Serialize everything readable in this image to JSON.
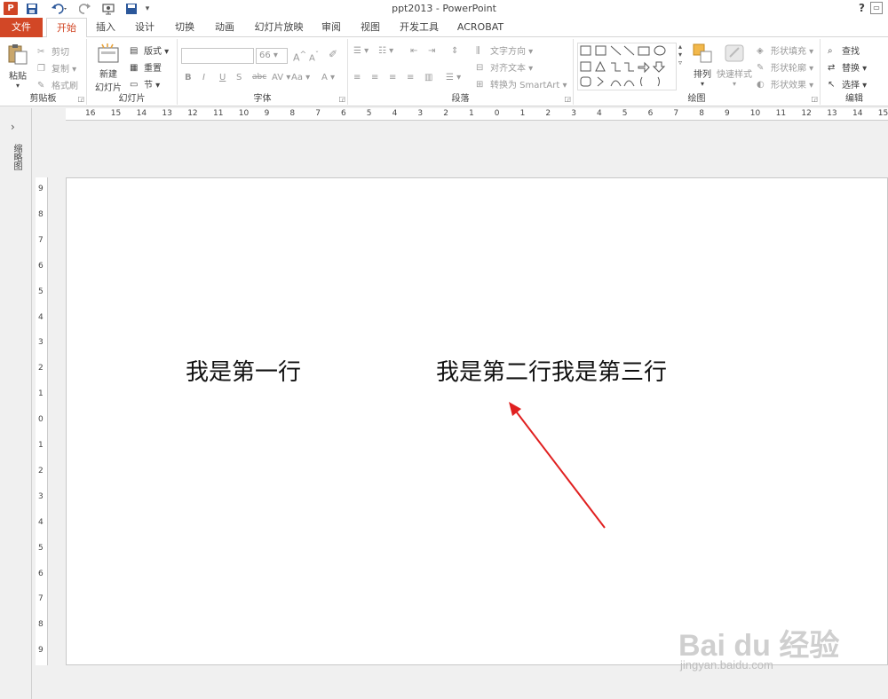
{
  "titlebar": {
    "app_logo": "P",
    "title": "ppt2013 - PowerPoint",
    "help": "?",
    "icons": [
      "save-icon",
      "undo-icon",
      "redo-icon",
      "start-slideshow-icon",
      "customize-icon"
    ]
  },
  "tabs": [
    "文件",
    "开始",
    "插入",
    "设计",
    "切换",
    "动画",
    "幻灯片放映",
    "审阅",
    "视图",
    "开发工具",
    "ACROBAT"
  ],
  "ribbon": {
    "clipboard": {
      "label": "剪贴板",
      "paste": "粘贴",
      "cut": "剪切",
      "copy": "复制",
      "format_painter": "格式刷"
    },
    "slides": {
      "label": "幻灯片",
      "new_slide_line1": "新建",
      "new_slide_line2": "幻灯片",
      "layout": "版式",
      "reset": "重置",
      "section": "节"
    },
    "font": {
      "label": "字体",
      "font_size": "66",
      "buttons": [
        "B",
        "I",
        "U",
        "S",
        "abc",
        "AV",
        "Aa",
        "A"
      ]
    },
    "paragraph": {
      "label": "段落",
      "text_direction": "文字方向",
      "align_text": "对齐文本",
      "convert_smartart": "转换为 SmartArt"
    },
    "drawing": {
      "label": "绘图",
      "arrange": "排列",
      "quick_styles": "快速样式",
      "shape_fill": "形状填充",
      "shape_outline": "形状轮廓",
      "shape_effects": "形状效果"
    },
    "editing": {
      "label": "编辑",
      "find": "查找",
      "replace": "替换",
      "select": "选择"
    }
  },
  "left_pane": {
    "label": "缩略图"
  },
  "ruler": {
    "h": [
      "16",
      "15",
      "14",
      "13",
      "12",
      "11",
      "10",
      "9",
      "8",
      "7",
      "6",
      "5",
      "4",
      "3",
      "2",
      "1",
      "0",
      "1",
      "2",
      "3",
      "4",
      "5",
      "6",
      "7",
      "8",
      "9",
      "10",
      "11",
      "12",
      "13",
      "14",
      "15"
    ],
    "v": [
      "9",
      "8",
      "7",
      "6",
      "5",
      "4",
      "3",
      "2",
      "1",
      "0",
      "1",
      "2",
      "3",
      "4",
      "5",
      "6",
      "7",
      "8",
      "9"
    ]
  },
  "slide": {
    "text_left": "我是第一行",
    "text_right": "我是第二行我是第三行"
  },
  "watermark": {
    "brand": "Bai du 经验",
    "url": "jingyan.baidu.com"
  }
}
